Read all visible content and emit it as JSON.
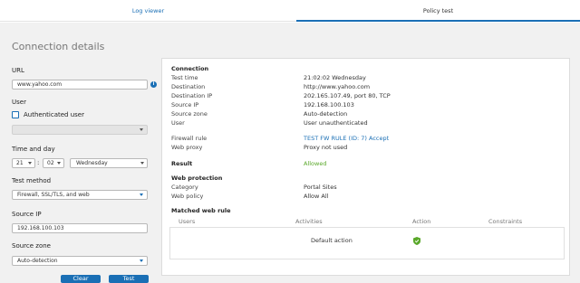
{
  "tabs": {
    "log_viewer": "Log viewer",
    "policy_test": "Policy test"
  },
  "form": {
    "heading": "Connection details",
    "url_label": "URL",
    "url_value": "www.yahoo.com",
    "user_label": "User",
    "authenticated_user_label": "Authenticated user",
    "time_label": "Time and day",
    "hour": "21",
    "minute": "02",
    "time_separator": ":",
    "day": "Wednesday",
    "test_method_label": "Test method",
    "test_method_value": "Firewall, SSL/TLS, and web",
    "source_ip_label": "Source IP",
    "source_ip_value": "192.168.100.103",
    "source_zone_label": "Source zone",
    "source_zone_value": "Auto-detection",
    "clear_button": "Clear",
    "test_button": "Test"
  },
  "result_panel": {
    "connection_heading": "Connection",
    "rows": [
      {
        "key": "Test time",
        "value": "21:02:02 Wednesday"
      },
      {
        "key": "Destination",
        "value": "http://www.yahoo.com"
      },
      {
        "key": "Destination IP",
        "value": "202.165.107.49, port 80, TCP"
      },
      {
        "key": "Source IP",
        "value": "192.168.100.103"
      },
      {
        "key": "Source zone",
        "value": "Auto-detection"
      },
      {
        "key": "User",
        "value": "User unauthenticated"
      }
    ],
    "firewall_rule_key": "Firewall rule",
    "firewall_rule_value": "TEST FW RULE (ID: 7) Accept",
    "web_proxy_key": "Web proxy",
    "web_proxy_value": "Proxy not used",
    "result_key": "Result",
    "result_value": "Allowed",
    "web_protection_heading": "Web protection",
    "category_key": "Category",
    "category_value": "Portal Sites",
    "web_policy_key": "Web policy",
    "web_policy_value": "Allow All",
    "matched_rule_heading": "Matched web rule",
    "columns": [
      "Users",
      "Activities",
      "Action",
      "Constraints"
    ],
    "default_action": "Default action"
  },
  "colors": {
    "accent": "#1a6fb5",
    "allowed": "#5aa82a"
  }
}
